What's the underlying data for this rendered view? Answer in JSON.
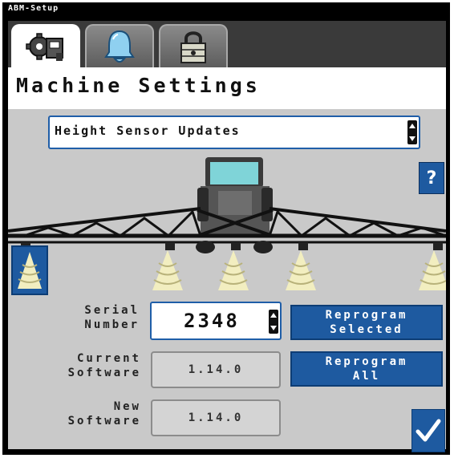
{
  "window": {
    "title": "ABM-Setup"
  },
  "tabs": [
    {
      "icon": "gear-machine-icon",
      "active": true
    },
    {
      "icon": "bell-icon",
      "active": false
    },
    {
      "icon": "lock-icon",
      "active": false
    }
  ],
  "header": {
    "title": "Machine Settings"
  },
  "dropdown": {
    "value": "Height Sensor Updates"
  },
  "help": {
    "label": "?"
  },
  "form": {
    "serial_label": "Serial\nNumber",
    "serial_value": "2348",
    "current_label": "Current\nSoftware",
    "current_value": "1.14.0",
    "new_label": "New\nSoftware",
    "new_value": "1.14.0"
  },
  "buttons": {
    "reprogram_selected": [
      "Reprogram",
      "Selected"
    ],
    "reprogram_all": [
      "Reprogram",
      "All"
    ]
  },
  "sensors": [
    {
      "id": 1,
      "selected": true
    },
    {
      "id": 2,
      "selected": false
    },
    {
      "id": 3,
      "selected": false
    },
    {
      "id": 4,
      "selected": false
    },
    {
      "id": 5,
      "selected": false
    }
  ],
  "colors": {
    "accent": "#1e5aa0",
    "sensor": "#f2eec0",
    "background": "#c9c9c9"
  }
}
